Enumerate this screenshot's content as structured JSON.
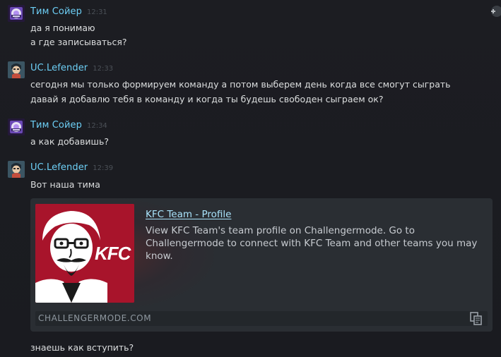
{
  "messages": [
    {
      "author": "Тим Сойер",
      "time": "12:31",
      "lines": [
        "да я понимаю",
        "а где записываться?"
      ]
    },
    {
      "author": "UC.Lefender",
      "time": "12:33",
      "lines": [
        "сегодня мы только формируем команду а потом выберем день когда все смогут сыграть",
        "давай я добавлю тебя в команду и когда ты будешь свободен сыграем ок?"
      ]
    },
    {
      "author": "Тим Сойер",
      "time": "12:34",
      "lines": [
        "а как добавишь?"
      ]
    },
    {
      "author": "UC.Lefender",
      "time": "12:39",
      "lines": [
        "Вот наша тима",
        "знаешь как вступить?"
      ]
    }
  ],
  "embed": {
    "title": "KFC Team - Profile",
    "description": "View KFC Team's team profile on Challengermode. Go to Challengermode to connect with KFC Team and other teams you may know.",
    "domain": "CHALLENGERMODE.COM",
    "thumb_text": "KFC"
  },
  "colors": {
    "author": "#6dcff6",
    "link": "#a9e3fb",
    "text": "#dcdedf",
    "timestamp": "#4b5057",
    "background": "#1b1c21",
    "embed_bg": "#2a2e33",
    "kfc_red": "#a8142b"
  },
  "icons": {
    "add": "add-icon",
    "copy": "copy-link-icon"
  }
}
